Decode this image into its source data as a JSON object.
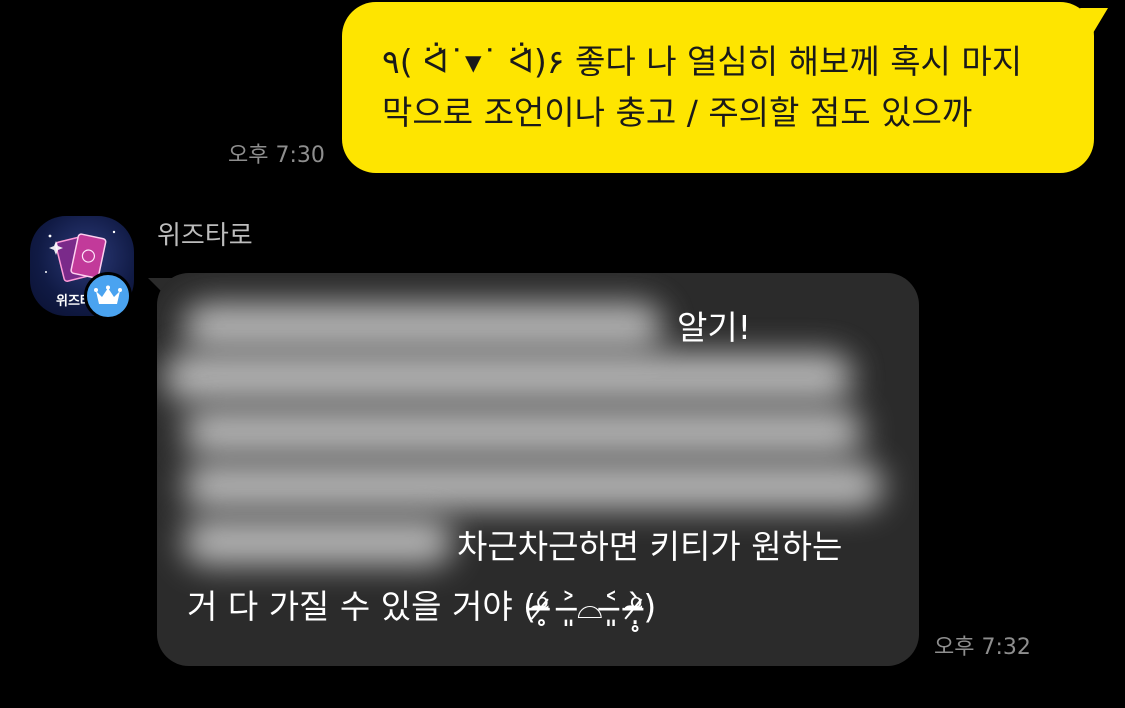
{
  "messages": {
    "outgoing": {
      "lines": [
        "٩( ᐛ̇˙▾˙ ᐛ̇)۶ 좋다 나 열심히 해보께 혹시 마지",
        "막으로 조언이나 충고 / 주의할 점도 있으까"
      ],
      "time": "오후 7:30"
    },
    "incoming": {
      "sender": "위즈타로",
      "avatar_label": "위즈타로",
      "visible_fragments": [
        "알기!",
        "차근차근하면 키티가 원하는",
        "거 다 가질 수 있을 거야 (ᵒ̴̶̷̥́ ˃̶͈⌓˂̶͈ ᵒ̴̶̷̣̥̀)"
      ],
      "time": "오후 7:32",
      "blurred": true
    }
  },
  "colors": {
    "background": "#000000",
    "outgoing_bubble": "#FEE500",
    "incoming_bubble": "#2b2b2b",
    "badge": "#4aa3f0",
    "timestamp": "#8e8e8e"
  },
  "icons": {
    "avatar": "tarot-cards-icon",
    "badge": "crown-icon"
  }
}
